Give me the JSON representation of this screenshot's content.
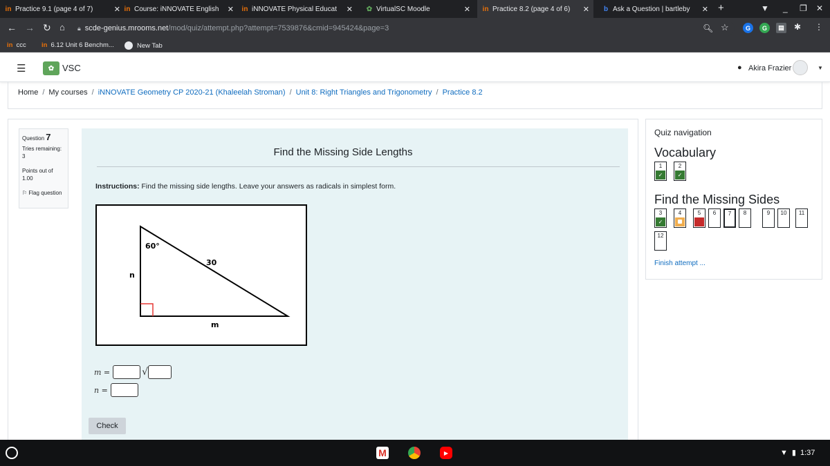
{
  "browser": {
    "tabs": [
      {
        "label": "Practice 9.1 (page 4 of 7)",
        "favicon": "in",
        "active": false
      },
      {
        "label": "Course: iNNOVATE English",
        "favicon": "in",
        "active": false
      },
      {
        "label": "iNNOVATE Physical Educat",
        "favicon": "in",
        "active": false
      },
      {
        "label": "VirtualSC Moodle",
        "favicon": "leaf-icon",
        "active": false
      },
      {
        "label": "Practice 8.2 (page 4 of 6)",
        "favicon": "in",
        "active": true
      },
      {
        "label": "Ask a Question | bartleby",
        "favicon": "b",
        "active": false
      }
    ],
    "url_domain": "scde-genius.mrooms.net",
    "url_path": "/mod/quiz/attempt.php?attempt=7539876&cmid=945424&page=3",
    "bookmarks": [
      {
        "label": "ccc",
        "favicon": "in"
      },
      {
        "label": "6.12 Unit 6 Benchm...",
        "favicon": "in"
      },
      {
        "label": "New Tab",
        "favicon": "globe-icon"
      }
    ]
  },
  "navbar": {
    "brand": "VSC",
    "user": "Akira Frazier"
  },
  "breadcrumb": [
    "Home",
    "My courses",
    "iNNOVATE Geometry CP 2020-21 (Khaleelah Stroman)",
    "Unit 8: Right Triangles and Trigonometry",
    "Practice 8.2"
  ],
  "question_info": {
    "label": "Question",
    "number": "7",
    "tries_label": "Tries remaining:",
    "tries_value": "3",
    "points_label": "Points out of",
    "points_value": "1.00",
    "flag_label": "Flag question"
  },
  "question": {
    "title": "Find the Missing Side Lengths",
    "instructions_bold": "Instructions:",
    "instructions_text": " Find the missing side lengths. Leave your answers as radicals in simplest form.",
    "diagram": {
      "angle_label": "60°",
      "hypotenuse_label": "30",
      "leg_vertical_label": "n",
      "leg_horizontal_label": "m"
    },
    "answer_m_label": "m =",
    "answer_n_label": "n =",
    "check_label": "Check"
  },
  "quiz_nav": {
    "heading": "Quiz navigation",
    "sections": [
      {
        "title": "Vocabulary",
        "questions": [
          {
            "num": "1",
            "state": "correct"
          },
          {
            "num": "2",
            "state": "correct"
          }
        ]
      },
      {
        "title": "Find the Missing Sides",
        "questions": [
          {
            "num": "3",
            "state": "correct"
          },
          {
            "num": "4",
            "state": "partial"
          },
          {
            "num": "5",
            "state": "wrong"
          },
          {
            "num": "6",
            "state": "notyet"
          },
          {
            "num": "7",
            "state": "current"
          },
          {
            "num": "8",
            "state": "notyet"
          },
          {
            "num": "9",
            "state": "notyet"
          },
          {
            "num": "10",
            "state": "notyet"
          },
          {
            "num": "11",
            "state": "notyet"
          },
          {
            "num": "12",
            "state": "notyet"
          }
        ]
      }
    ],
    "finish_label": "Finish attempt ..."
  },
  "taskbar": {
    "time": "1:37"
  },
  "colors": {
    "accent": "#0f6cbf",
    "correct": "#357a32",
    "partial": "#f0ad4e",
    "wrong": "#c52b2b",
    "question_bg": "#e7f3f5"
  }
}
